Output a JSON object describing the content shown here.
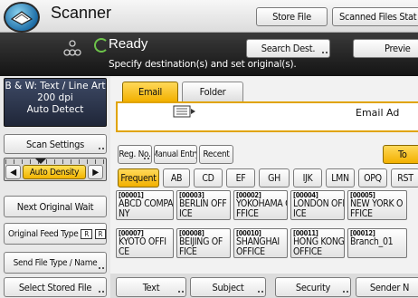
{
  "header": {
    "app_title": "Scanner",
    "store_file": "Store File",
    "scanned_files_status": "Scanned Files Stat"
  },
  "status": {
    "state": "Ready",
    "message": "Specify destination(s) and set original(s).",
    "search_dest": "Search Dest.",
    "preview": "Previe"
  },
  "settings": {
    "line1": "B & W: Text / Line Art",
    "line2": "200 dpi",
    "line3": "Auto Detect"
  },
  "left": {
    "scan_settings": "Scan Settings",
    "auto_density": "Auto Density",
    "next_original_wait": "Next Original Wait",
    "original_feed_type": "Original Feed Type",
    "send_file_type": "Send File Type / Name",
    "select_stored_file": "Select Stored File",
    "density_left": "◀",
    "density_right": "▶"
  },
  "tabs": {
    "email": "Email",
    "folder": "Folder",
    "email_address": "Email Ad"
  },
  "dest_buttons": {
    "reg_no": "Reg. No.",
    "manual_entry": "Manual Entry",
    "recent": "Recent",
    "to": "To"
  },
  "title_tabs": [
    "Frequent",
    "AB",
    "CD",
    "EF",
    "GH",
    "IJK",
    "LMN",
    "OPQ",
    "RST"
  ],
  "destinations": [
    {
      "num": "[00001]",
      "line1": "ABCD COMPA",
      "line2": "NY"
    },
    {
      "num": "[00003]",
      "line1": "BERLIN OFF",
      "line2": "ICE"
    },
    {
      "num": "[00002]",
      "line1": "YOKOHAMA O",
      "line2": "FFICE"
    },
    {
      "num": "[00004]",
      "line1": "LONDON OFF",
      "line2": "ICE"
    },
    {
      "num": "[00005]",
      "line1": "NEW YORK O",
      "line2": "FFICE"
    },
    {
      "num": "[00007]",
      "line1": "KYOTO OFFI",
      "line2": "CE"
    },
    {
      "num": "[00008]",
      "line1": "BEIJING OF",
      "line2": "FICE"
    },
    {
      "num": "[00010]",
      "line1": "SHANGHAI",
      "line2": "OFFICE"
    },
    {
      "num": "[00011]",
      "line1": "HONG KONG",
      "line2": "OFFICE"
    },
    {
      "num": "[00012]",
      "line1": "Branch_01",
      "line2": ""
    }
  ],
  "bottom": {
    "text": "Text",
    "subject": "Subject",
    "security": "Security",
    "sender": "Sender N"
  }
}
